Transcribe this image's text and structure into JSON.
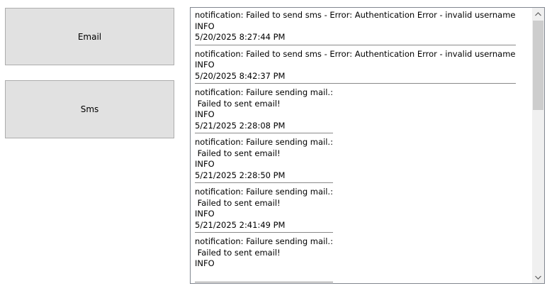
{
  "buttons": {
    "email_label": "Email",
    "sms_label": "Sms"
  },
  "log": {
    "entries": [
      {
        "message_lines": [
          "notification: Failed to send sms - Error: Authentication Error - invalid username"
        ],
        "level": "INFO",
        "timestamp": "5/20/2025 8:27:44 PM"
      },
      {
        "message_lines": [
          "notification: Failed to send sms - Error: Authentication Error - invalid username"
        ],
        "level": "INFO",
        "timestamp": "5/20/2025 8:42:37 PM"
      },
      {
        "message_lines": [
          "notification: Failure sending mail.:",
          " Failed to sent email!"
        ],
        "level": "INFO",
        "timestamp": "5/21/2025 2:28:08 PM"
      },
      {
        "message_lines": [
          "notification: Failure sending mail.:",
          " Failed to sent email!"
        ],
        "level": "INFO",
        "timestamp": "5/21/2025 2:28:50 PM"
      },
      {
        "message_lines": [
          "notification: Failure sending mail.:",
          " Failed to sent email!"
        ],
        "level": "INFO",
        "timestamp": "5/21/2025 2:41:49 PM"
      },
      {
        "message_lines": [
          "notification: Failure sending mail.:",
          " Failed to sent email!"
        ],
        "level": "INFO",
        "timestamp": ""
      }
    ]
  },
  "scrollbar": {
    "up_icon": "chevron-up-icon",
    "down_icon": "chevron-down-icon"
  }
}
